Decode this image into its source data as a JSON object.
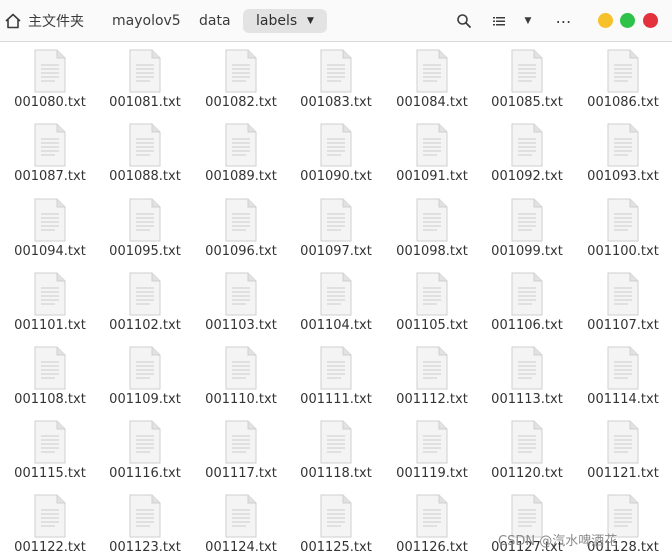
{
  "breadcrumb": {
    "home_label": "主文件夹",
    "items": [
      "mayolov5",
      "data",
      "labels"
    ]
  },
  "toolbar": {
    "icons": [
      "search-icon",
      "list-view-icon",
      "chevron-down-icon",
      "more-menu-icon"
    ],
    "window_controls": {
      "minimize_color": "#f7c12c",
      "maximize_color": "#2fc24a",
      "close_color": "#e3313e"
    }
  },
  "files": [
    "001080.txt",
    "001081.txt",
    "001082.txt",
    "001083.txt",
    "001084.txt",
    "001085.txt",
    "001086.txt",
    "001087.txt",
    "001088.txt",
    "001089.txt",
    "001090.txt",
    "001091.txt",
    "001092.txt",
    "001093.txt",
    "001094.txt",
    "001095.txt",
    "001096.txt",
    "001097.txt",
    "001098.txt",
    "001099.txt",
    "001100.txt",
    "001101.txt",
    "001102.txt",
    "001103.txt",
    "001104.txt",
    "001105.txt",
    "001106.txt",
    "001107.txt",
    "001108.txt",
    "001109.txt",
    "001110.txt",
    "001111.txt",
    "001112.txt",
    "001113.txt",
    "001114.txt",
    "001115.txt",
    "001116.txt",
    "001117.txt",
    "001118.txt",
    "001119.txt",
    "001120.txt",
    "001121.txt",
    "001122.txt",
    "001123.txt",
    "001124.txt",
    "001125.txt",
    "001126.txt",
    "001127.txt",
    "001128.txt"
  ],
  "file_icon": "text-file-icon",
  "watermark": "CSDN @汽水啤酒花"
}
